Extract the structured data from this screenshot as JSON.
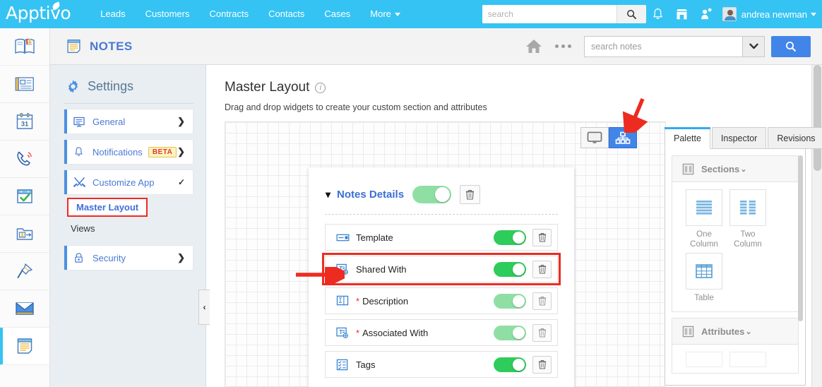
{
  "topbar": {
    "logo": "Apptivo",
    "nav": [
      {
        "label": "Leads"
      },
      {
        "label": "Customers"
      },
      {
        "label": "Contracts"
      },
      {
        "label": "Contacts"
      },
      {
        "label": "Cases"
      },
      {
        "label": "More"
      }
    ],
    "search_placeholder": "search",
    "search_value": "",
    "icons": [
      "bell-icon",
      "store-icon",
      "user-add-icon"
    ],
    "username": "andrea newman",
    "brand_color": "#35c3f3"
  },
  "rail": {
    "items": [
      {
        "name": "journal-icon"
      },
      {
        "name": "news-card-icon"
      },
      {
        "name": "calendar-icon",
        "day": "31"
      },
      {
        "name": "phone-call-icon"
      },
      {
        "name": "tasks-check-icon"
      },
      {
        "name": "contact-folder-icon"
      },
      {
        "name": "pin-icon"
      },
      {
        "name": "envelope-icon"
      },
      {
        "name": "notes-icon",
        "active": true
      }
    ]
  },
  "notes_header": {
    "title": "NOTES",
    "title_color": "#4a79d4",
    "home_icon": "home-icon",
    "more_icon": "ellipsis-icon",
    "search_placeholder": "search notes",
    "search_value": "",
    "dropdown_icon": "chevron-down-icon",
    "go_icon": "search-icon"
  },
  "settings": {
    "title": "Settings",
    "items": [
      {
        "label": "General",
        "icon": "monitor-icon",
        "chevron": "❯",
        "badge": null
      },
      {
        "label": "Notifications",
        "icon": "bell-icon",
        "chevron": "❯",
        "badge": "BETA"
      },
      {
        "label": "Customize App",
        "icon": "tools-icon",
        "chevron": "❯",
        "badge": null,
        "expanded": true
      },
      {
        "label": "Security",
        "icon": "lock-icon",
        "chevron": "❯",
        "badge": null
      }
    ],
    "sub_items": [
      {
        "label": "Master Layout",
        "selected": true
      },
      {
        "label": "Views",
        "selected": false
      }
    ],
    "collapse_handle": "‹"
  },
  "main": {
    "page_title": "Master Layout",
    "info_icon": "info-icon",
    "subtitle": "Drag and drop widgets to create your custom section and attributes",
    "toolbar": [
      {
        "name": "desktop-view-icon",
        "active": false
      },
      {
        "name": "hierarchy-view-icon",
        "active": true
      }
    ]
  },
  "form_card": {
    "section_title": "Notes Details",
    "section_toggle": {
      "state": "on",
      "faded": true
    },
    "section_delete_icon": "trash-icon",
    "collapse_chevron": "⌄",
    "fields": [
      {
        "label": "Template",
        "icon": "dropdown-field-icon",
        "required": false,
        "toggle": "on",
        "faded": false,
        "highlighted": false
      },
      {
        "label": "Shared With",
        "icon": "text-link-field-icon",
        "required": false,
        "toggle": "on",
        "faded": false,
        "highlighted": true
      },
      {
        "label": "Description",
        "icon": "textarea-field-icon",
        "required": true,
        "toggle": "on",
        "faded": true,
        "highlighted": false
      },
      {
        "label": "Associated With",
        "icon": "text-link-field-icon",
        "required": true,
        "toggle": "on",
        "faded": true,
        "highlighted": false
      },
      {
        "label": "Tags",
        "icon": "checklist-field-icon",
        "required": false,
        "toggle": "on",
        "faded": false,
        "highlighted": false
      }
    ]
  },
  "palette": {
    "tabs": [
      {
        "label": "Palette",
        "active": true
      },
      {
        "label": "Inspector",
        "active": false
      },
      {
        "label": "Revisions",
        "active": false
      }
    ],
    "groups": [
      {
        "title": "Sections",
        "icon": "columns-icon",
        "chevron": "⌄",
        "items": [
          {
            "label": "One Column",
            "icon": "one-column-icon"
          },
          {
            "label": "Two Column",
            "icon": "two-column-icon"
          },
          {
            "label": "Table",
            "icon": "table-icon"
          }
        ]
      },
      {
        "title": "Attributes",
        "icon": "columns-icon",
        "chevron": "⌄",
        "items": []
      }
    ]
  },
  "colors": {
    "toggle_on": "#2ecc5a",
    "toggle_faded": "#8fdfa4",
    "annotation_red": "#ee2b20",
    "accent_blue": "#4285e8"
  }
}
